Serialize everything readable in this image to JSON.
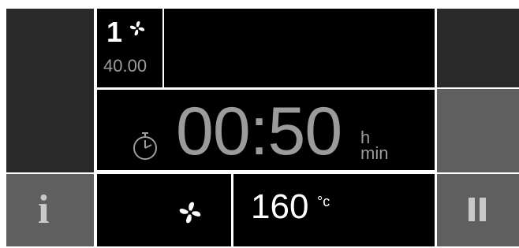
{
  "step": {
    "number": "1",
    "value": "40.00",
    "icon": "fan-icon"
  },
  "timer": {
    "value": "00:50",
    "unit_hours": "h",
    "unit_minutes": "min",
    "icon": "timer-icon"
  },
  "fan": {
    "icon": "fan-icon"
  },
  "temperature": {
    "value": "160",
    "unit": "°c"
  },
  "buttons": {
    "info": {
      "icon": "info-icon",
      "glyph": "i"
    },
    "pause": {
      "icon": "pause-icon"
    }
  },
  "colors": {
    "panel_dark": "#2a2a2a",
    "panel_black": "#000000",
    "panel_gray": "#5f5f5f",
    "text_white": "#ffffff",
    "text_gray": "#9b9b9b"
  }
}
